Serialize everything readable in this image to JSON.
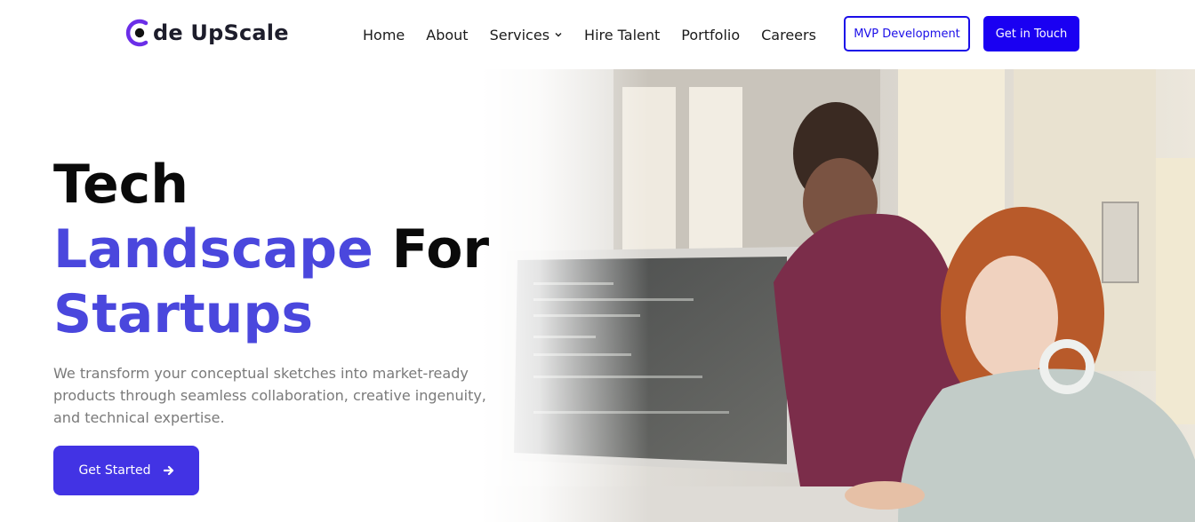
{
  "brand": {
    "logo_text": "de UpScale",
    "accent_color": "#4a47dd",
    "primary_color": "#1a00f2"
  },
  "nav": {
    "items": [
      {
        "label": "Home"
      },
      {
        "label": "About"
      },
      {
        "label": "Services",
        "has_dropdown": true,
        "icon": "chevron-down-icon"
      },
      {
        "label": "Hire Talent"
      },
      {
        "label": "Portfolio"
      },
      {
        "label": "Careers"
      }
    ],
    "mvp_button": "MVP Development",
    "contact_button": "Get in Touch"
  },
  "hero": {
    "headline_line1": "Tech",
    "headline_accent_1": "Landscape",
    "headline_line2_rest": " For",
    "headline_accent_2": "Startups",
    "description": "We transform your conceptual sketches into market-ready products through seamless collaboration, creative ingenuity, and technical expertise.",
    "cta_label": "Get Started",
    "cta_icon": "arrow-right-icon",
    "image": "people-working-at-computer-photo"
  }
}
